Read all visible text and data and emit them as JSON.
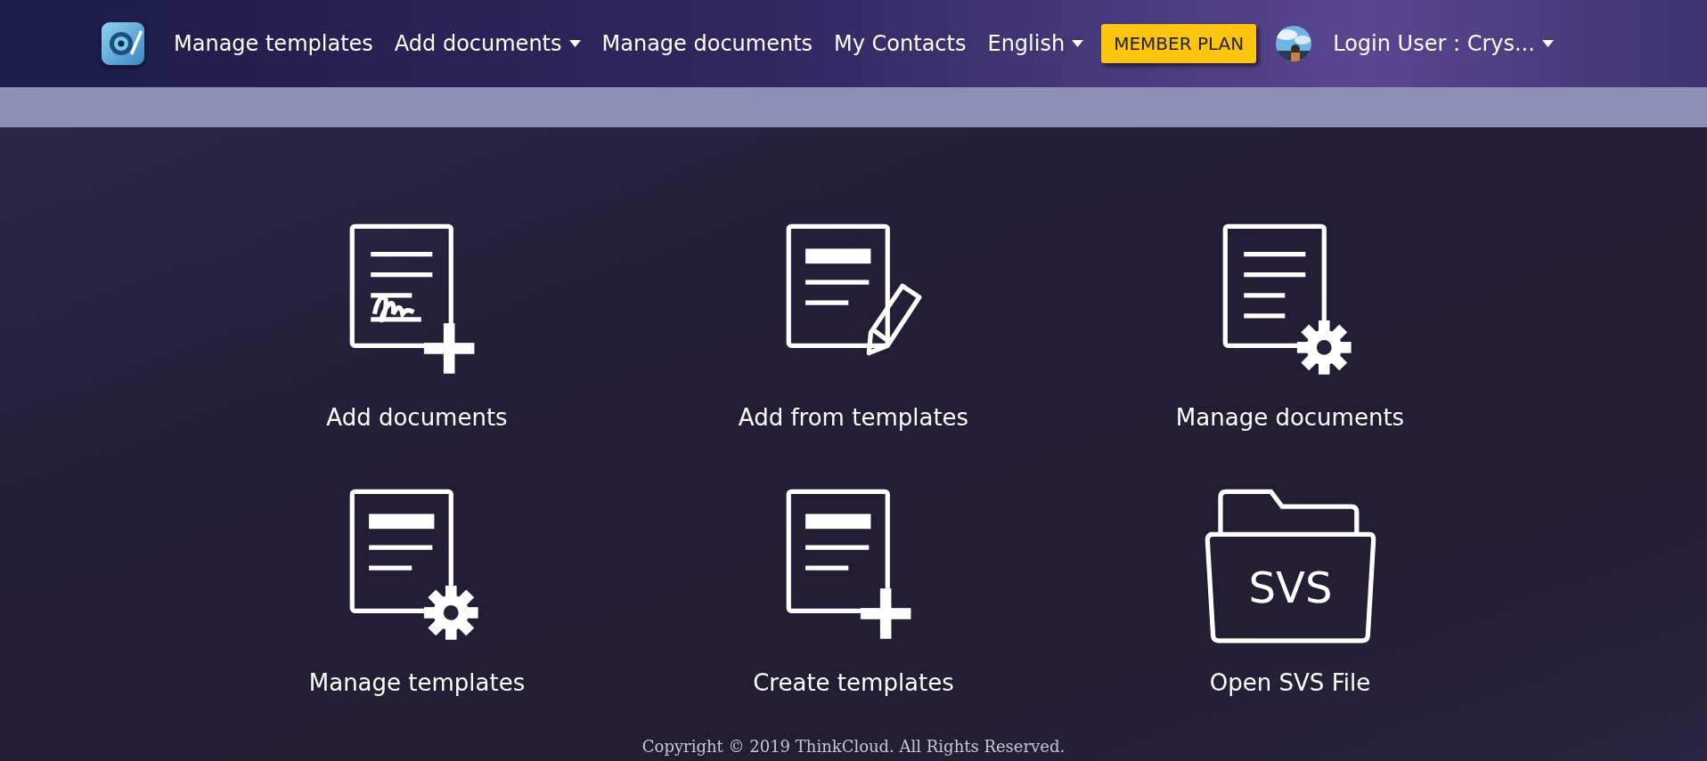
{
  "navbar": {
    "links": [
      {
        "label": "Manage templates",
        "dropdown": false
      },
      {
        "label": "Add documents",
        "dropdown": true
      },
      {
        "label": "Manage documents",
        "dropdown": false
      },
      {
        "label": "My Contacts",
        "dropdown": false
      },
      {
        "label": "English",
        "dropdown": true
      }
    ],
    "plan_button": "MEMBER PLAN",
    "user": {
      "label": "Login User : Crys...",
      "dropdown": true
    }
  },
  "tiles": [
    {
      "kind": "sign-add",
      "label": "Add documents"
    },
    {
      "kind": "bar-pencil",
      "label": "Add from templates"
    },
    {
      "kind": "lines-gear",
      "label": "Manage documents"
    },
    {
      "kind": "bar-gear",
      "label": "Manage templates"
    },
    {
      "kind": "bar-add",
      "label": "Create templates"
    },
    {
      "kind": "folder",
      "label": "Open SVS File",
      "badge": "SVS"
    }
  ],
  "footer": "Copyright © 2019 ThinkCloud. All Rights Reserved."
}
